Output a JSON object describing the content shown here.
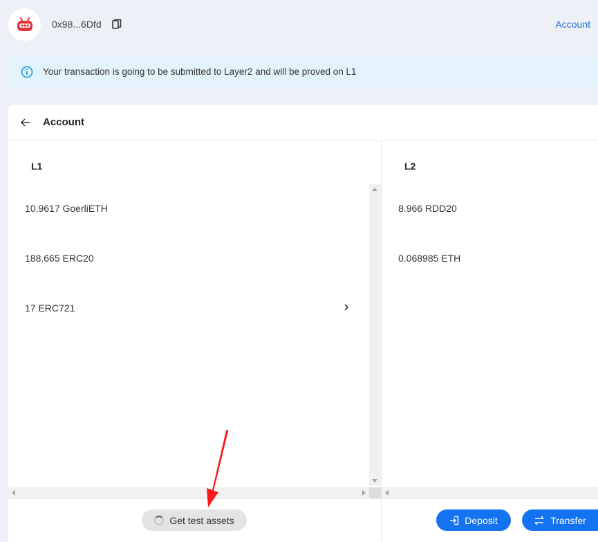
{
  "header": {
    "address": "0x98...6Dfd",
    "account_link": "Account",
    "avatar_icon": "robot-logo-icon",
    "copy_icon": "copy-icon"
  },
  "alert": {
    "message": "Your transaction is going to be submitted to Layer2 and will be proved on L1",
    "icon": "info-icon"
  },
  "card": {
    "title": "Account",
    "l1": {
      "label": "L1",
      "assets": [
        "10.9617 GoerliETH",
        "188.665 ERC20",
        "17 ERC721"
      ]
    },
    "l2": {
      "label": "L2",
      "assets": [
        "8.966 RDD20",
        "0.068985 ETH"
      ]
    }
  },
  "actions": {
    "get_test_assets": "Get test assets",
    "deposit": "Deposit",
    "transfer": "Transfer"
  },
  "colors": {
    "accent": "#1473f0",
    "background": "#eef0f7",
    "alert_bg": "#e2f3fb",
    "annotation": "#ff1a1a"
  }
}
